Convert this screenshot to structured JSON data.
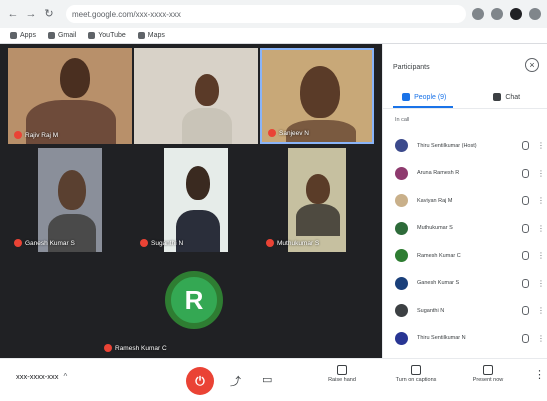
{
  "browser": {
    "url": "meet.google.com/xxx-xxxx-xxx",
    "bookmarks": [
      "Apps",
      "Gmail",
      "YouTube",
      "Maps"
    ]
  },
  "tiles": [
    {
      "name": "Rajiv Raj M",
      "bg": "#b8906a"
    },
    {
      "name": "",
      "bg": "#d8d2c8"
    },
    {
      "name": "Sanjeev N",
      "bg": "#c8a878"
    },
    {
      "name": "Ganesh Kumar S",
      "bg": "#8a8f9a"
    },
    {
      "name": "Suganthi N",
      "bg": "#e6ece9"
    },
    {
      "name": "Muthukumar S",
      "bg": "#c6c0a0"
    }
  ],
  "avatar_tile": {
    "initial": "R",
    "name": "Ramesh Kumar C",
    "color": "#34a853"
  },
  "panel": {
    "title": "Participants",
    "close_icon": "close-icon",
    "tabs": [
      {
        "label": "People (9)",
        "icon": "people-icon",
        "active": true
      },
      {
        "label": "Chat",
        "icon": "chat-icon",
        "active": false
      }
    ],
    "in_call_label": "In call",
    "participants": [
      {
        "name": "Thiru Sentilkumar (Host)",
        "color": "#3c4a8c"
      },
      {
        "name": "Aruna Ramesh R",
        "color": "#8e3a6e"
      },
      {
        "name": "Kaviyan Raj M",
        "color": "#c9b08a"
      },
      {
        "name": "Muthukumar S",
        "color": "#2e6b3a"
      },
      {
        "name": "Ramesh Kumar C",
        "color": "#2e7d32"
      },
      {
        "name": "Ganesh Kumar S",
        "color": "#1a3f7a"
      },
      {
        "name": "Suganthi N",
        "color": "#3c4043"
      },
      {
        "name": "Thiru Sentilkumar N",
        "color": "#283593"
      }
    ]
  },
  "controls": {
    "meeting_code": "xxx-xxxx-xxx",
    "leave_label": "⏻",
    "actions": [
      {
        "label": "Raise hand",
        "icon": "raise-hand-icon"
      },
      {
        "label": "Turn on captions",
        "icon": "captions-icon"
      },
      {
        "label": "Present now",
        "icon": "present-icon"
      }
    ]
  }
}
